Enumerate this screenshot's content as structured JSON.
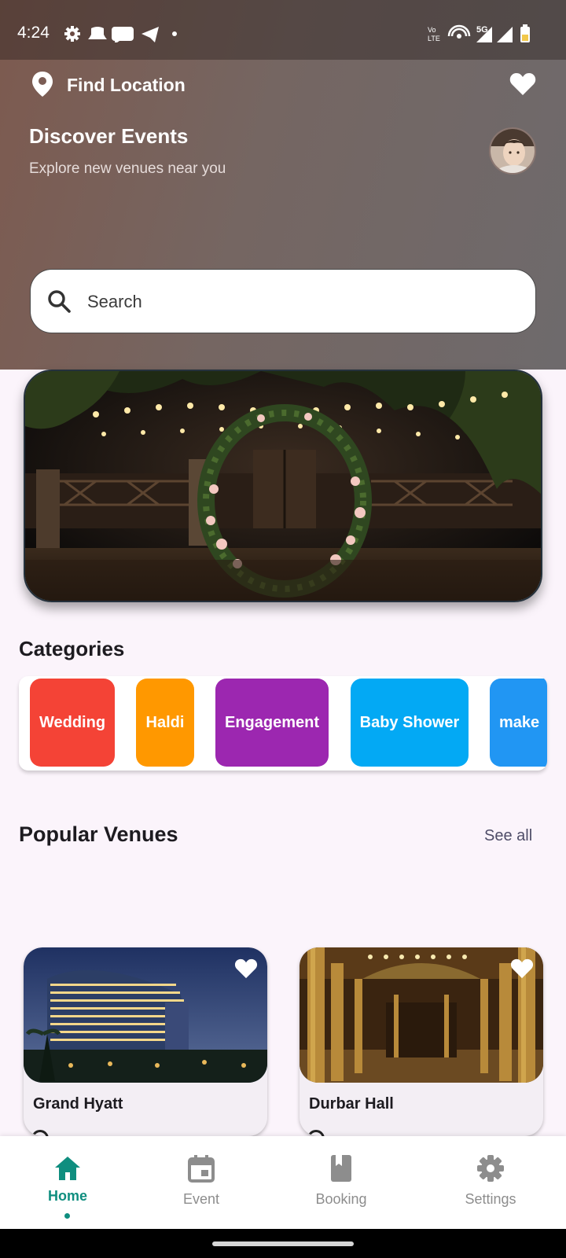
{
  "status_bar": {
    "time": "4:24",
    "network": "5G",
    "volte": "Vo LTE"
  },
  "header": {
    "location_label": "Find Location",
    "title": "Discover Events",
    "subtitle": "Explore new venues near you",
    "search_placeholder": "Search",
    "gradient_colors": [
      "#7d5a4f",
      "#6e6a6c"
    ]
  },
  "categories": {
    "title": "Categories",
    "items": [
      {
        "label": "Wedding",
        "color": "#f44336"
      },
      {
        "label": "Haldi",
        "color": "#ff9800"
      },
      {
        "label": "Engagement",
        "color": "#9c27b0"
      },
      {
        "label": "Baby Shower",
        "color": "#03a9f4"
      },
      {
        "label": "make",
        "color": "#2196f3"
      }
    ]
  },
  "popular_venues": {
    "title": "Popular Venues",
    "see_all": "See all",
    "items": [
      {
        "name": "Grand Hyatt",
        "favorite": true
      },
      {
        "name": "Durbar Hall",
        "favorite": true
      }
    ]
  },
  "bottom_nav": {
    "items": [
      {
        "label": "Home",
        "icon": "home-icon",
        "active": true
      },
      {
        "label": "Event",
        "icon": "calendar-icon",
        "active": false
      },
      {
        "label": "Booking",
        "icon": "book-icon",
        "active": false
      },
      {
        "label": "Settings",
        "icon": "gear-icon",
        "active": false
      }
    ],
    "active_color": "#0f8e7f"
  }
}
